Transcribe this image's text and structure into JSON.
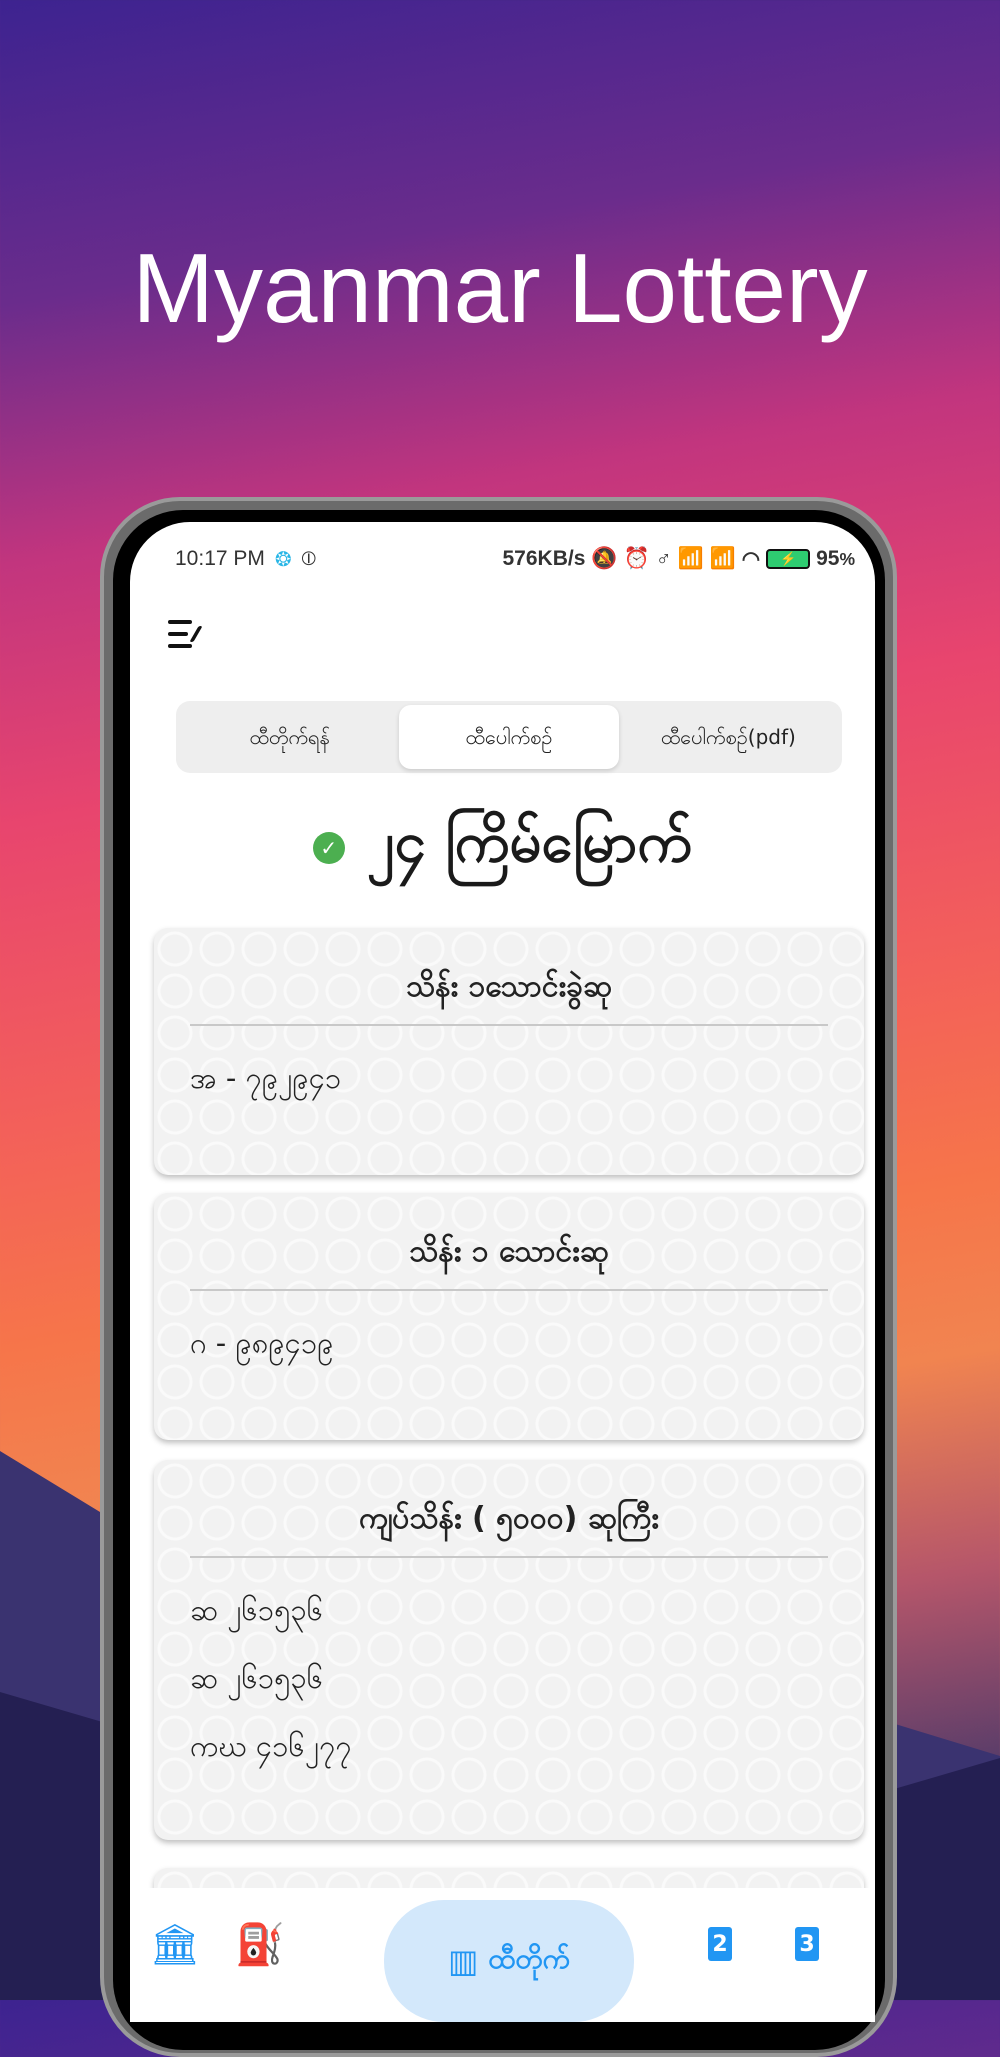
{
  "promo_title": "Myanmar Lottery",
  "status_bar": {
    "time": "10:17 PM",
    "net_speed": "576KB/s",
    "battery": "95",
    "battery_unit": "%"
  },
  "tabs": [
    {
      "label": "ထီတိုက်ရန်"
    },
    {
      "label": "ထီပေါက်စဉ်",
      "active": true
    },
    {
      "label": "ထီပေါက်စဉ်(pdf)"
    }
  ],
  "heading": "၂၄ ကြိမ်မြောက်",
  "cards": [
    {
      "title": "သိန်း ၁သောင်းခွဲဆု",
      "values": [
        "အ - ၇၉၂၉၄၁"
      ]
    },
    {
      "title": "သိန်း ၁ သောင်းဆု",
      "values": [
        "ဂ - ၉၈၉၄၁၉"
      ]
    },
    {
      "title": "ကျပ်သိန်း ( ၅၀၀၀) ဆုကြီး",
      "values": [
        "ဆ ၂၆၁၅၃၆",
        "ဆ ၂၆၁၅၃၆",
        "ကဃ ၄၁၆၂၇၇"
      ]
    }
  ],
  "bottom_nav": {
    "active_label": "ထီတိုက်",
    "item2": "2",
    "item3": "3"
  },
  "colors": {
    "accent": "#2196f3",
    "pill": "#d3e8fb",
    "check": "#4caf50"
  }
}
